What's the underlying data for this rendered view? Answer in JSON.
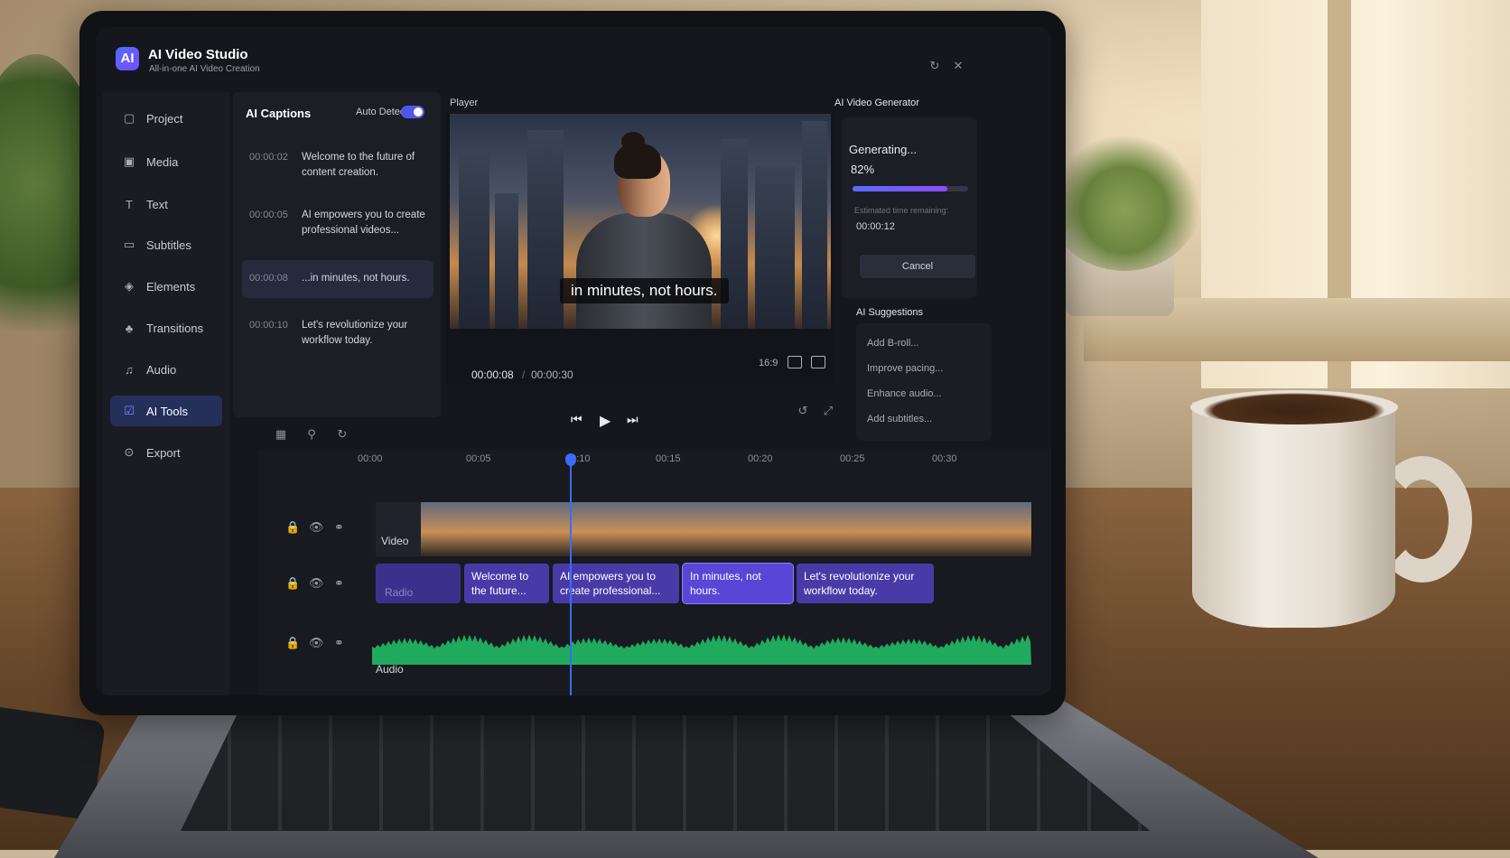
{
  "app": {
    "logo": "AI",
    "title": "AI Video Studio",
    "subtitle": "All-in-one AI Video Creation"
  },
  "window_controls": [
    {
      "name": "refresh-icon",
      "glyph": "↻"
    },
    {
      "name": "close-icon",
      "glyph": "✕"
    }
  ],
  "sidebar": {
    "items": [
      {
        "label": "Project",
        "icon": "folder-icon",
        "glyph": "▢",
        "active": false
      },
      {
        "label": "Media",
        "icon": "media-icon",
        "glyph": "▣",
        "active": false
      },
      {
        "label": "Text",
        "icon": "text-icon",
        "glyph": "T",
        "active": false
      },
      {
        "label": "Subtitles",
        "icon": "subtitles-icon",
        "glyph": "▭",
        "active": false
      },
      {
        "label": "Elements",
        "icon": "elements-icon",
        "glyph": "◈",
        "active": false
      },
      {
        "label": "Transitions",
        "icon": "transitions-icon",
        "glyph": "♣",
        "active": false
      },
      {
        "label": "Audio",
        "icon": "music-icon",
        "glyph": "♫",
        "active": false
      },
      {
        "label": "AI Tools",
        "icon": "ai-tools-icon",
        "glyph": "☑",
        "active": true
      },
      {
        "label": "Export",
        "icon": "export-icon",
        "glyph": "⊙",
        "active": false
      }
    ]
  },
  "captions_panel": {
    "title": "AI Captions",
    "auto_detect_label": "Auto Detect",
    "auto_detect_on": true,
    "rows": [
      {
        "time": "00:00:02",
        "text": "Welcome to the future of content creation.",
        "active": false
      },
      {
        "time": "00:00:05",
        "text": "AI empowers you to create professional videos...",
        "active": false
      },
      {
        "time": "00:00:08",
        "text": "...in minutes, not hours.",
        "active": true
      },
      {
        "time": "00:00:10",
        "text": "Let's revolutionize your workflow today.",
        "active": false
      }
    ]
  },
  "player": {
    "label": "Player",
    "caption_overlay": "in minutes, not hours.",
    "current_time": "00:00:08",
    "separator": "/",
    "duration": "00:00:30",
    "aspect_ratio": "16:9"
  },
  "generator": {
    "label": "AI Video Generator",
    "status": "Generating...",
    "percent_label": "82%",
    "progress": 0.82,
    "eta_label": "Estimated time remaining:",
    "eta": "00:00:12",
    "cancel_label": "Cancel"
  },
  "suggestions": {
    "label": "AI Suggestions",
    "items": [
      "Add B-roll...",
      "Improve pacing...",
      "Enhance audio...",
      "Add subtitles..."
    ]
  },
  "transport": {
    "prev_glyph": "⏮",
    "play_glyph": "▶",
    "next_glyph": "⏭"
  },
  "timeline": {
    "ruler": [
      "00:00",
      "00:05",
      "00:10",
      "00:15",
      "00:20",
      "00:25",
      "00:30"
    ],
    "tracks": {
      "video": "Video",
      "captions": "Radio",
      "audio": "Audio"
    },
    "caption_clips": [
      {
        "text": "Welcome to the future..."
      },
      {
        "text": "AI empowers you to create professional..."
      },
      {
        "text": "In minutes, not hours."
      },
      {
        "text": "Let's revolutionize your workflow today."
      }
    ]
  },
  "colors": {
    "accent": "#3e6bff",
    "clip": "#4a3aa8",
    "waveform": "#22c46a",
    "progress": "#5b6bff"
  }
}
